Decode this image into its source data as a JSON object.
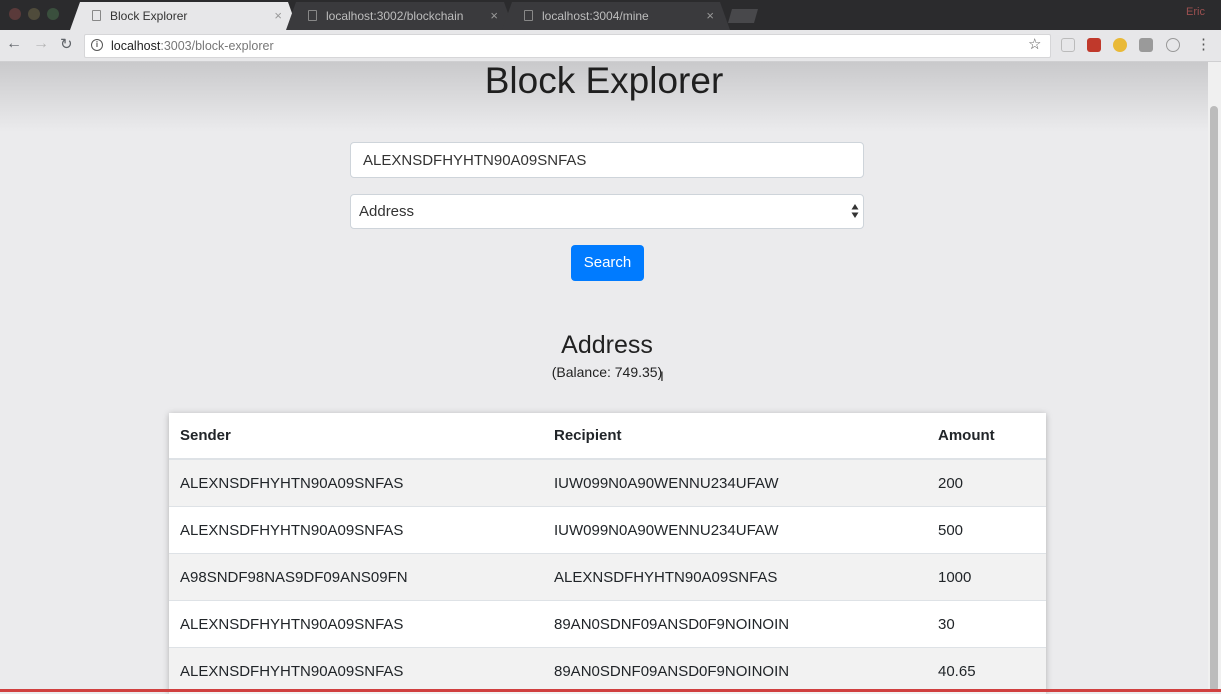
{
  "browser": {
    "tabs": [
      {
        "label": "Block Explorer",
        "close": "×",
        "active": true
      },
      {
        "label": "localhost:3002/blockchain",
        "close": "×",
        "active": false
      },
      {
        "label": "localhost:3004/mine",
        "close": "×",
        "active": false
      }
    ],
    "profile_name": "Eric",
    "url_host": "localhost",
    "url_path": ":3003/block-explorer"
  },
  "page": {
    "title": "Block Explorer",
    "search_value": "ALEXNSDFHYHTN90A09SNFAS",
    "search_type": "Address",
    "search_button": "Search",
    "section_heading": "Address",
    "balance_text": "(Balance: 749.35)"
  },
  "table": {
    "headers": {
      "sender": "Sender",
      "recipient": "Recipient",
      "amount": "Amount"
    },
    "rows": [
      {
        "sender": "ALEXNSDFHYHTN90A09SNFAS",
        "recipient": "IUW099N0A90WENNU234UFAW",
        "amount": "200"
      },
      {
        "sender": "ALEXNSDFHYHTN90A09SNFAS",
        "recipient": "IUW099N0A90WENNU234UFAW",
        "amount": "500"
      },
      {
        "sender": "A98SNDF98NAS9DF09ANS09FN",
        "recipient": "ALEXNSDFHYHTN90A09SNFAS",
        "amount": "1000"
      },
      {
        "sender": "ALEXNSDFHYHTN90A09SNFAS",
        "recipient": "89AN0SDNF09ANSD0F9NOINOIN",
        "amount": "30"
      },
      {
        "sender": "ALEXNSDFHYHTN90A09SNFAS",
        "recipient": "89AN0SDNF09ANSD0F9NOINOIN",
        "amount": "40.65"
      }
    ]
  },
  "colors": {
    "primary_button": "#007bff",
    "page_background": "#ebebed"
  }
}
